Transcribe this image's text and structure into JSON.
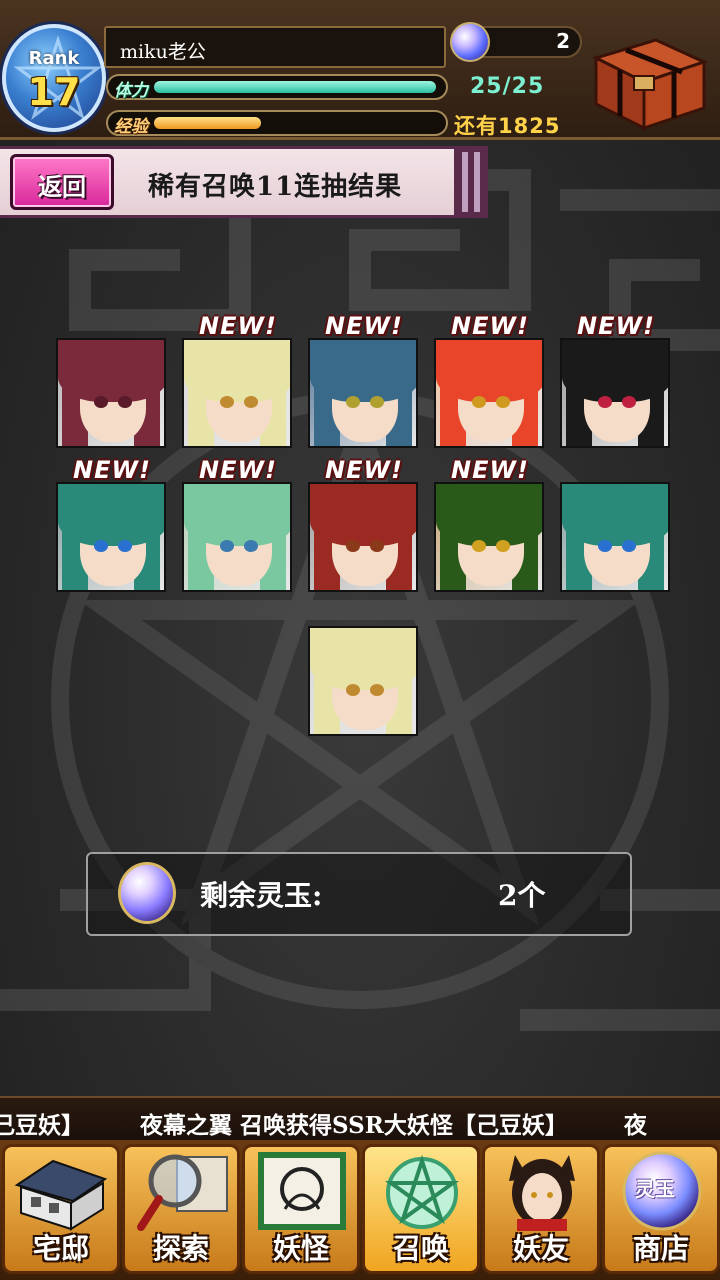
{
  "header": {
    "rank_label": "Rank",
    "rank_value": "17",
    "player_name": "miku老公",
    "gem_count": "2",
    "stamina_label": "体力",
    "stamina_value": "25/25",
    "stamina_fraction": 1.0,
    "exp_label": "经验",
    "exp_remaining": "还有1825",
    "exp_fraction": 0.38
  },
  "title_bar": {
    "back_label": "返回",
    "title": "稀有召唤11连抽结果"
  },
  "results": {
    "new_label": "NEW!",
    "cards": [
      {
        "name": "result-card-1",
        "is_new": false,
        "hair": "#7a2a3a",
        "eye": "#5a1a2a",
        "bg": "#b4b4b4"
      },
      {
        "name": "result-card-2",
        "is_new": true,
        "hair": "#e8e4a8",
        "eye": "#c08a30",
        "bg": "#d8d8d8"
      },
      {
        "name": "result-card-3",
        "is_new": true,
        "hair": "#3a6a8a",
        "eye": "#b0a030",
        "bg": "#5a7a9a"
      },
      {
        "name": "result-card-4",
        "is_new": true,
        "hair": "#e8452a",
        "eye": "#d09a20",
        "bg": "#f0c0a0"
      },
      {
        "name": "result-card-5",
        "is_new": true,
        "hair": "#1a1a1a",
        "eye": "#c02040",
        "bg": "#9a9a9a"
      },
      {
        "name": "result-card-6",
        "is_new": true,
        "hair": "#2a8a7a",
        "eye": "#2a70d0",
        "bg": "#8aa0a0"
      },
      {
        "name": "result-card-7",
        "is_new": true,
        "hair": "#7ac8a0",
        "eye": "#3a7ab0",
        "bg": "#b8d0b8"
      },
      {
        "name": "result-card-8",
        "is_new": true,
        "hair": "#9a2a22",
        "eye": "#8a3a1a",
        "bg": "#a0a0a0"
      },
      {
        "name": "result-card-9",
        "is_new": true,
        "hair": "#2a5a1a",
        "eye": "#d0a020",
        "bg": "#c8a878"
      },
      {
        "name": "result-card-10",
        "is_new": false,
        "hair": "#2a8a7a",
        "eye": "#2a70d0",
        "bg": "#8aa0a0"
      },
      {
        "name": "result-card-11",
        "is_new": false,
        "hair": "#e8e4a8",
        "eye": "#c08a30",
        "bg": "#d8d8d8"
      }
    ]
  },
  "remaining": {
    "label": "剩余灵玉:",
    "count": "2个"
  },
  "ticker": {
    "fragment": "己豆妖】",
    "message": "夜幕之翼 召唤获得SSR大妖怪【己豆妖】",
    "tail": "夜"
  },
  "nav": {
    "items": [
      {
        "key": "home",
        "label": "宅邸"
      },
      {
        "key": "explore",
        "label": "探索"
      },
      {
        "key": "yokai",
        "label": "妖怪"
      },
      {
        "key": "summon",
        "label": "召唤"
      },
      {
        "key": "friends",
        "label": "妖友"
      },
      {
        "key": "shop",
        "label": "商店"
      }
    ],
    "shop_badge": "灵玉"
  }
}
